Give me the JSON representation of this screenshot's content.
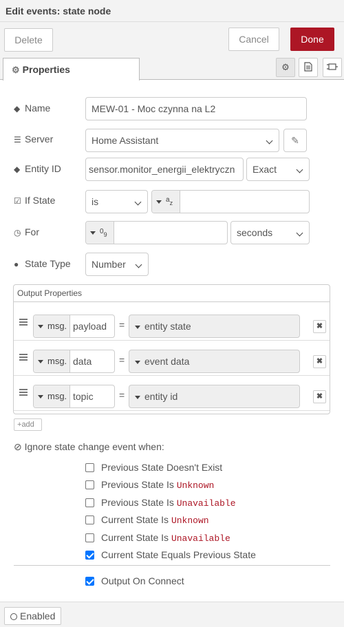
{
  "title": "Edit events: state node",
  "toolbar": {
    "delete_label": "Delete",
    "cancel_label": "Cancel",
    "done_label": "Done",
    "done_color": "#ad1625"
  },
  "tabs": {
    "properties_label": "Properties",
    "icons": [
      "gear-icon",
      "document-icon",
      "layout-icon"
    ]
  },
  "fields": {
    "name": {
      "label": "Name",
      "value": "MEW-01 - Moc czynna na L2"
    },
    "server": {
      "label": "Server",
      "value": "Home Assistant"
    },
    "entity_id": {
      "label": "Entity ID",
      "value": "sensor.monitor_energii_elektryczn",
      "match": "Exact"
    },
    "if_state": {
      "label": "If State",
      "operator": "is",
      "type_glyph": "a",
      "type_sub": "z",
      "value": ""
    },
    "for": {
      "label": "For",
      "type_glyph": "0",
      "type_sub": "9",
      "value": "",
      "unit": "seconds"
    },
    "state_type": {
      "label": "State Type",
      "value": "Number"
    }
  },
  "output_properties": {
    "title": "Output Properties",
    "rows": [
      {
        "prefix": "msg.",
        "property": "payload",
        "eq": "=",
        "value": "entity state"
      },
      {
        "prefix": "msg.",
        "property": "data",
        "eq": "=",
        "value": "event data"
      },
      {
        "prefix": "msg.",
        "property": "topic",
        "eq": "=",
        "value": "entity id"
      }
    ],
    "add_label": "add"
  },
  "ignore": {
    "title": "Ignore state change event when:",
    "options": [
      {
        "text": "Previous State Doesn't Exist",
        "code": "",
        "checked": false
      },
      {
        "text": "Previous State Is ",
        "code": "Unknown",
        "checked": false
      },
      {
        "text": "Previous State Is ",
        "code": "Unavailable",
        "checked": false
      },
      {
        "text": "Current State Is ",
        "code": "Unknown",
        "checked": false
      },
      {
        "text": "Current State Is ",
        "code": "Unavailable",
        "checked": false
      },
      {
        "text": "Current State Equals Previous State",
        "code": "",
        "checked": true
      }
    ]
  },
  "output_on_connect": {
    "text": "Output On Connect",
    "checked": true
  },
  "footer": {
    "enabled_label": "Enabled"
  }
}
